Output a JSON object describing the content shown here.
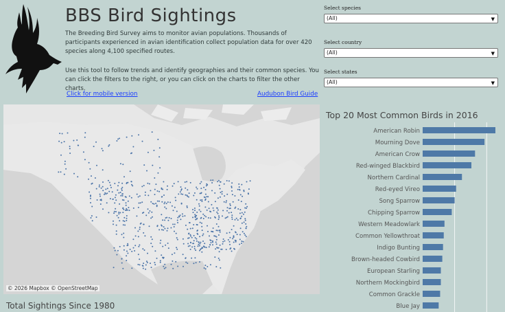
{
  "header": {
    "title": "BBS Bird Sightings",
    "desc1": "The Breeding Bird Survey aims to monitor avian populations. Thousands of participants experienced in avian identification collect population data for over 420 species along 4,100 specified routes.",
    "desc2": "Use this tool to follow trends and identify geographies and their common species. You can click the filters to the right, or you can click on the charts to filter the other charts.",
    "mobile_link": "Click for mobile version",
    "audubon_link": "Audubon Bird Guide"
  },
  "filters": {
    "species": {
      "label": "Select species",
      "value": "(All)"
    },
    "country": {
      "label": "Select country",
      "value": "(All)"
    },
    "states": {
      "label": "Select states",
      "value": "(All)"
    }
  },
  "map": {
    "credit": "© 2026 Mapbox  © OpenStreetMap",
    "dot_color": "#4b74a8"
  },
  "bottom": {
    "totals_title": "Total Sightings Since 1980"
  },
  "chart_data": {
    "type": "bar",
    "title": "Top 20 Most Common Birds in 2016",
    "orientation": "horizontal",
    "bar_color": "#4e79a7",
    "categories": [
      "American Robin",
      "Mourning Dove",
      "American Crow",
      "Red-winged Blackbird",
      "Northern Cardinal",
      "Red-eyed Vireo",
      "Song Sparrow",
      "Chipping Sparrow",
      "Western Meadowlark",
      "Common Yellowthroat",
      "Indigo Bunting",
      "Brown-headed Cowbird",
      "European Starling",
      "Northern Mockingbird",
      "Common Grackle",
      "Blue Jay"
    ],
    "values": [
      100,
      85,
      72,
      67,
      54,
      46,
      44,
      40,
      30,
      29,
      28,
      27,
      25,
      25,
      24,
      22
    ],
    "xlim": [
      0,
      100
    ],
    "grid": true
  }
}
